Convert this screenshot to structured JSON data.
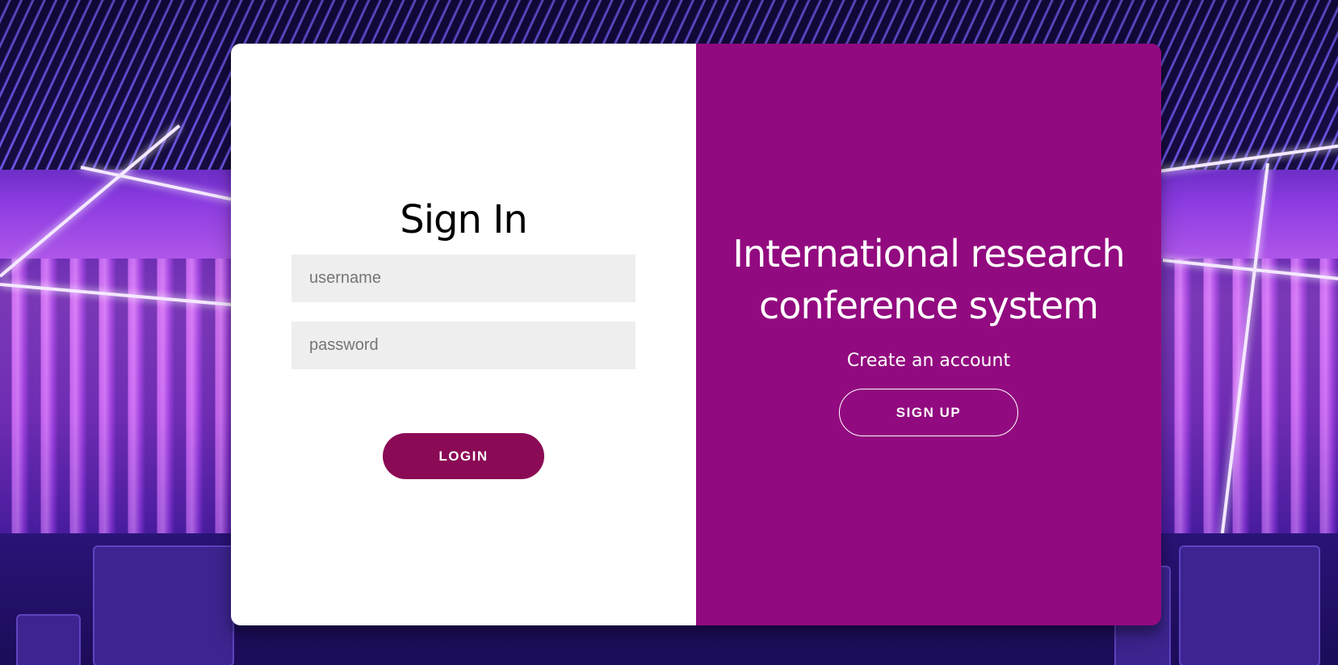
{
  "signin": {
    "title": "Sign In",
    "username_placeholder": "username",
    "password_placeholder": "password",
    "login_label": "LOGIN"
  },
  "promo": {
    "headline": "International research conference system",
    "subtext": "Create an account",
    "signup_label": "SIGN UP"
  },
  "colors": {
    "accent_panel": "#920a7f",
    "login_button": "#8b0a55",
    "input_background": "#eeeeee"
  }
}
